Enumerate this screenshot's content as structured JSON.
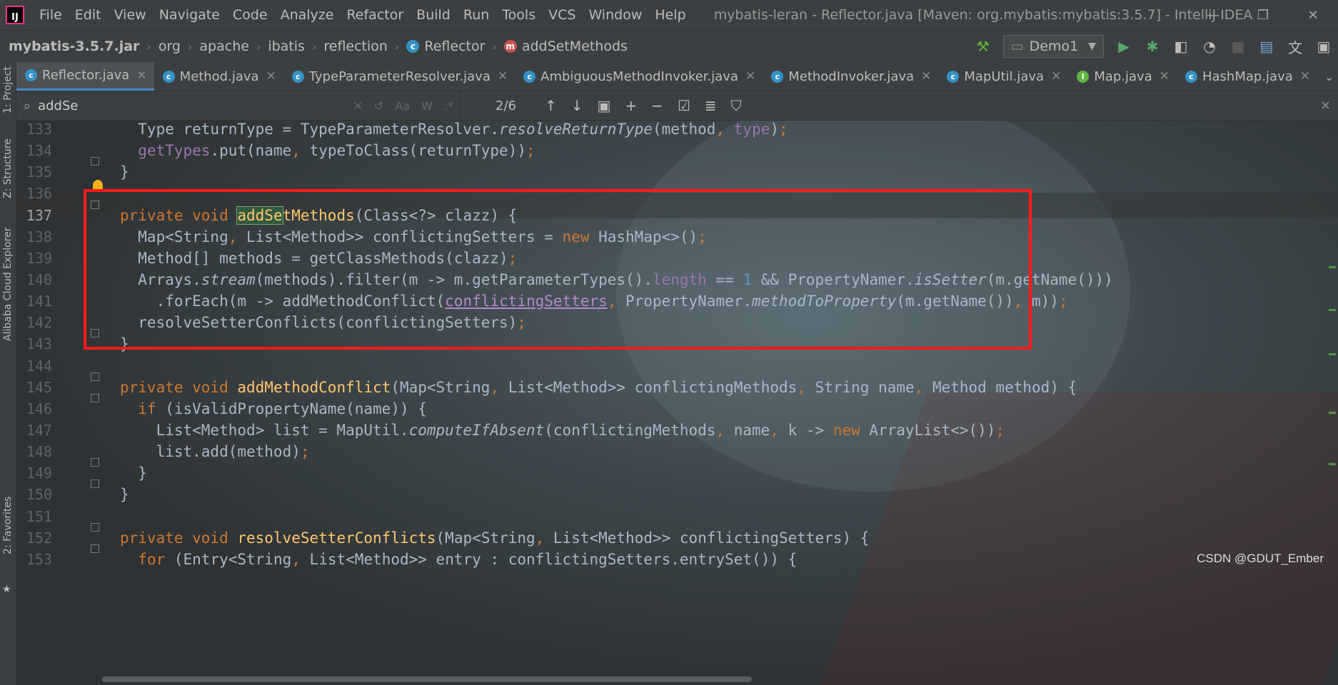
{
  "menubar": {
    "app_icon": "IJ",
    "items": [
      "File",
      "Edit",
      "View",
      "Navigate",
      "Code",
      "Analyze",
      "Refactor",
      "Build",
      "Run",
      "Tools",
      "VCS",
      "Window",
      "Help"
    ],
    "title": "mybatis-leran - Reflector.java [Maven: org.mybatis:mybatis:3.5.7] - IntelliJ IDEA",
    "window_controls": [
      "—",
      "❐",
      "✕"
    ]
  },
  "breadcrumb": {
    "items": [
      "mybatis-3.5.7.jar",
      "org",
      "apache",
      "ibatis",
      "reflection",
      "Reflector",
      "addSetMethods"
    ]
  },
  "toolbar": {
    "run_config": "Demo1",
    "icons": [
      "hammer-icon",
      "run-icon",
      "debug-icon",
      "coverage-icon",
      "profile-icon",
      "stop-icon",
      "project-structure-icon",
      "translate-icon",
      "layout-icon"
    ]
  },
  "side_tabs": {
    "project": "1: Project",
    "structure": "Z: Structure",
    "alibaba": "Alibaba Cloud Explorer",
    "favorites": "2: Favorites"
  },
  "tabs": [
    {
      "label": "Reflector.java",
      "active": true,
      "kind": "class"
    },
    {
      "label": "Method.java",
      "active": false,
      "kind": "class"
    },
    {
      "label": "TypeParameterResolver.java",
      "active": false,
      "kind": "class"
    },
    {
      "label": "AmbiguousMethodInvoker.java",
      "active": false,
      "kind": "class"
    },
    {
      "label": "MethodInvoker.java",
      "active": false,
      "kind": "class"
    },
    {
      "label": "MapUtil.java",
      "active": false,
      "kind": "class"
    },
    {
      "label": "Map.java",
      "active": false,
      "kind": "interface"
    },
    {
      "label": "HashMap.java",
      "active": false,
      "kind": "class"
    }
  ],
  "find": {
    "query": "addSe",
    "options": [
      "Aa",
      "W",
      ".*"
    ],
    "match_count": "2/6"
  },
  "editor": {
    "line_numbers": [
      "133",
      "134",
      "135",
      "136",
      "137",
      "138",
      "139",
      "140",
      "141",
      "142",
      "143",
      "144",
      "145",
      "146",
      "147",
      "148",
      "149",
      "150",
      "151",
      "152",
      "153"
    ],
    "current_line": "137"
  },
  "watermark": "CSDN @GDUT_Ember",
  "colors": {
    "keyword": "#cc7832",
    "function": "#ffc66d",
    "text": "#a9b7c6",
    "number": "#6897bb",
    "field": "#9876aa",
    "highlight_box": "#ff1a1a"
  }
}
